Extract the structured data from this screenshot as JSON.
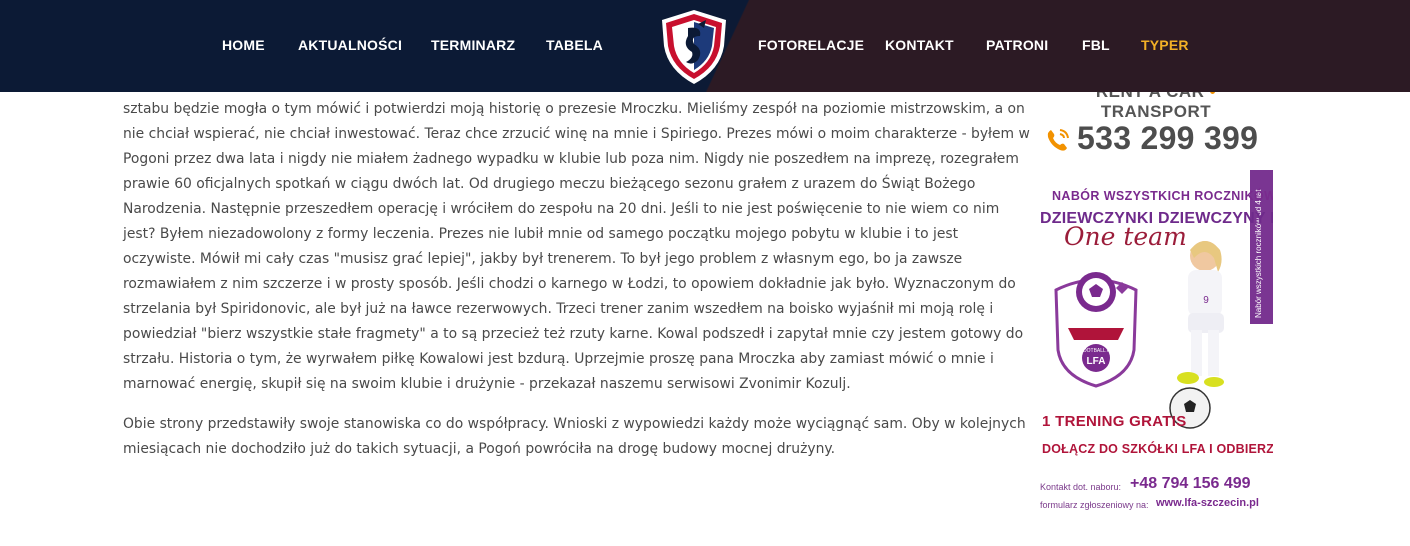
{
  "nav": {
    "left_items": [
      {
        "label": "HOME"
      },
      {
        "label": "AKTUALNOŚCI"
      },
      {
        "label": "TERMINARZ"
      },
      {
        "label": "TABELA"
      }
    ],
    "right_items": [
      {
        "label": "FOTORELACJE"
      },
      {
        "label": "KONTAKT"
      },
      {
        "label": "PATRONI"
      },
      {
        "label": "FBL"
      },
      {
        "label": "TYPER"
      }
    ],
    "active_color": "#f2b026",
    "logo_icon": "club-crest-icon"
  },
  "article": {
    "paragraph1": [
      "sztabu będzie mogła o tym mówić i potwierdzi moją historię o prezesie Mroczku. Mieliśmy zespół na poziomie mistrzowskim, a on",
      "nie chciał wspierać, nie chciał inwestować. Teraz chce zrzucić winę na mnie i Spiriego. Prezes mówi o moim charakterze - byłem w",
      "Pogoni przez dwa lata i nigdy nie miałem żadnego wypadku w klubie lub poza nim. Nigdy nie poszedłem na imprezę, rozegrałem",
      "prawie 60 oficjalnych spotkań w ciągu dwóch lat. Od drugiego meczu bieżącego sezonu grałem z urazem do Świąt Bożego",
      "Narodzenia. Następnie przeszedłem operację i wróciłem do zespołu na 20 dni. Jeśli to nie jest poświęcenie to nie wiem co nim",
      "jest? Byłem niezadowolony z formy leczenia. Prezes nie lubił mnie od samego początku mojego pobytu w klubie i to jest",
      "oczywiste. Mówił mi cały czas \"musisz grać lepiej\", jakby był trenerem. To był jego problem z własnym ego, bo ja zawsze",
      "rozmawiałem z nim szczerze i w prosty sposób. Jeśli chodzi o karnego w Łodzi, to opowiem dokładnie jak było. Wyznaczonym do",
      "strzelania był Spiridonovic, ale był już na ławce rezerwowych. Trzeci trener zanim wszedłem na boisko wyjaśnił mi moją rolę i",
      "powiedział \"bierz wszystkie stałe fragmety\" a to są przecież też rzuty karne. Kowal podszedł i zapytał mnie czy jestem gotowy do",
      "strzału. Historia o tym, że wyrwałem piłkę Kowalowi jest bzdurą. Uprzejmie proszę pana Mroczka aby zamiast mówić o mnie i",
      "marnować energię, skupił się na swoim klubie i drużynie - przekazał naszemu serwisowi Zvonimir Kozulj."
    ],
    "paragraph2": [
      "Obie strony przedstawiły swoje stanowiska co do współpracy. Wnioski z wypowiedzi każdy może wyciągnąć sam. Oby w kolejnych",
      "miesiącach nie dochodziło już do takich sytuacji, a Pogoń powróciła na drogę budowy mocnej drużyny."
    ]
  },
  "sidebar": {
    "rent_left": "RENT A CAR",
    "rent_sep": "•",
    "rent_right": "TRANSPORT",
    "phone_icon": "phone-icon",
    "phone": "533 299 399",
    "accent_color": "#f29200",
    "ad": {
      "nabor": "NABÓR WSZYSTKICH ROCZNIKÓW",
      "girls": "DZIEWCZYNKI DZIEWCZYNY KOBIETY",
      "one_team": "One team",
      "side_text": "Nabór wszystkich roczników od 4 lat",
      "badge_text_top": "LADIES FOOTBALL ACADEMY",
      "badge_text": "LFA",
      "gratis": "1 TRENING GRATIS",
      "dolacz": "DOŁĄCZ DO SZKÓŁKI LFA I ODBIERZ KOSZULKĘ !",
      "kontakt_label": "Kontakt dot. naboru:",
      "kontakt_phone": "+48 794 156 499",
      "form_label": "formularz zgłoszeniowy na:",
      "url": "www.lfa-szczecin.pl",
      "shirt_number": "9",
      "brand_color": "#7a2a8e"
    }
  }
}
